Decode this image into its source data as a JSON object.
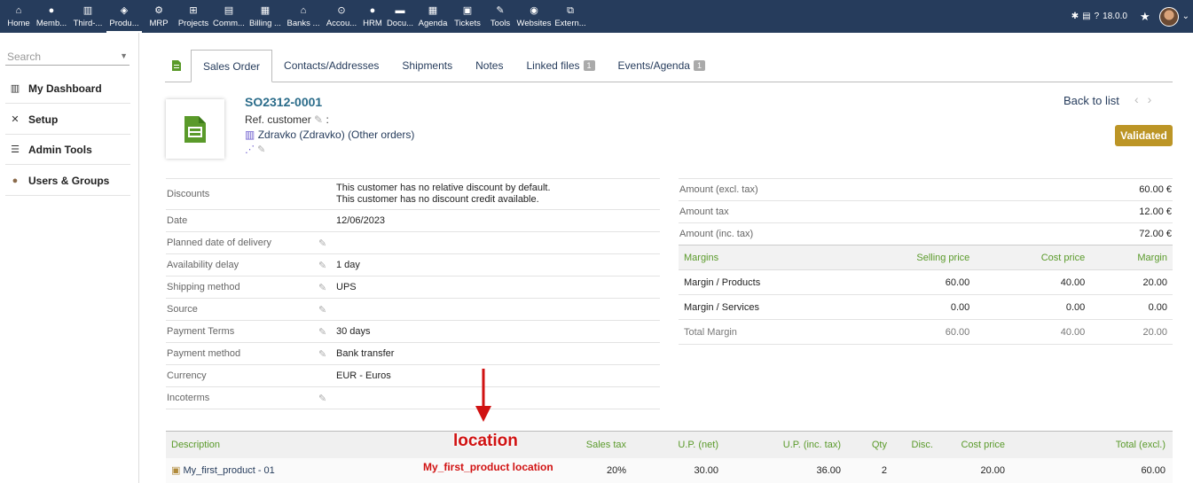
{
  "topnav": {
    "items": [
      {
        "label": "Home",
        "icon": "home-icon",
        "glyph": "⌂"
      },
      {
        "label": "Memb...",
        "icon": "user-icon",
        "glyph": "●"
      },
      {
        "label": "Third-...",
        "icon": "building-icon",
        "glyph": "▥"
      },
      {
        "label": "Produ...",
        "icon": "cube-icon",
        "glyph": "◈"
      },
      {
        "label": "MRP",
        "icon": "cubes-icon",
        "glyph": "⚙"
      },
      {
        "label": "Projects",
        "icon": "sitemap-icon",
        "glyph": "⊞"
      },
      {
        "label": "Comm...",
        "icon": "briefcase-icon",
        "glyph": "▤"
      },
      {
        "label": "Billing ...",
        "icon": "invoice-icon",
        "glyph": "▦"
      },
      {
        "label": "Banks ...",
        "icon": "bank-icon",
        "glyph": "⌂"
      },
      {
        "label": "Accou...",
        "icon": "magnifier-icon",
        "glyph": "⊙"
      },
      {
        "label": "HRM",
        "icon": "users-icon",
        "glyph": "●"
      },
      {
        "label": "Docu...",
        "icon": "folder-icon",
        "glyph": "▬"
      },
      {
        "label": "Agenda",
        "icon": "calendar-icon",
        "glyph": "▦"
      },
      {
        "label": "Tickets",
        "icon": "ticket-icon",
        "glyph": "▣"
      },
      {
        "label": "Tools",
        "icon": "wrench-icon",
        "glyph": "✎"
      },
      {
        "label": "Websites",
        "icon": "globe-icon",
        "glyph": "◉"
      },
      {
        "label": "Extern...",
        "icon": "external-link-icon",
        "glyph": "⧉"
      }
    ],
    "version": "18.0.0"
  },
  "leftmenu": {
    "search_placeholder": "Search",
    "entries": [
      {
        "label": "My Dashboard",
        "icon": "chart-icon"
      },
      {
        "label": "Setup",
        "icon": "tools-icon"
      },
      {
        "label": "Admin Tools",
        "icon": "server-icon"
      },
      {
        "label": "Users & Groups",
        "icon": "user-icon"
      }
    ]
  },
  "tabs": [
    {
      "label": "Sales Order",
      "active": true
    },
    {
      "label": "Contacts/Addresses"
    },
    {
      "label": "Shipments"
    },
    {
      "label": "Notes"
    },
    {
      "label": "Linked files",
      "badge": "1"
    },
    {
      "label": "Events/Agenda",
      "badge": "1"
    }
  ],
  "header": {
    "ref": "SO2312-0001",
    "ref_customer_label": "Ref. customer",
    "ref_customer_sep": ":",
    "customer": "Zdravko (Zdravko)",
    "other_orders": "(Other orders)",
    "back_to_list": "Back to list",
    "status": "Validated"
  },
  "info": [
    {
      "label": "Discounts",
      "value": "This customer has no relative discount by default.\nThis customer has no discount credit available.",
      "edit": false
    },
    {
      "label": "Date",
      "value": "12/06/2023",
      "edit": false
    },
    {
      "label": "Planned date of delivery",
      "value": "",
      "edit": true
    },
    {
      "label": "Availability delay",
      "value": "1 day",
      "edit": true
    },
    {
      "label": "Shipping method",
      "value": "UPS",
      "edit": true
    },
    {
      "label": "Source",
      "value": "",
      "edit": true
    },
    {
      "label": "Payment Terms",
      "value": "30 days",
      "edit": true
    },
    {
      "label": "Payment method",
      "value": "Bank transfer",
      "edit": true
    },
    {
      "label": "Currency",
      "value": "EUR - Euros",
      "edit": false
    },
    {
      "label": "Incoterms",
      "value": "",
      "edit": true
    }
  ],
  "amounts": [
    {
      "label": "Amount (excl. tax)",
      "value": "60.00 €"
    },
    {
      "label": "Amount tax",
      "value": "12.00 €"
    },
    {
      "label": "Amount (inc. tax)",
      "value": "72.00 €"
    }
  ],
  "margins": {
    "headers": [
      "Margins",
      "Selling price",
      "Cost price",
      "Margin"
    ],
    "rows": [
      [
        "Margin / Products",
        "60.00",
        "40.00",
        "20.00"
      ],
      [
        "Margin / Services",
        "0.00",
        "0.00",
        "0.00"
      ],
      [
        "Total Margin",
        "60.00",
        "40.00",
        "20.00"
      ]
    ]
  },
  "lines": {
    "headers": [
      "Description",
      "Sales tax",
      "U.P. (net)",
      "U.P. (inc. tax)",
      "Qty",
      "Disc.",
      "Cost price",
      "Total (excl.)"
    ],
    "rows": [
      [
        "My_first_product - 01",
        "20%",
        "30.00",
        "36.00",
        "2",
        "",
        "20.00",
        "60.00"
      ]
    ]
  },
  "annotation": {
    "title": "location",
    "subtitle": "My_first_product location",
    "color": "#d01212"
  },
  "colors": {
    "topbar": "#263c5c",
    "status": "#bc9526",
    "link": "#263c5c",
    "header_green": "#5a9a2a"
  }
}
